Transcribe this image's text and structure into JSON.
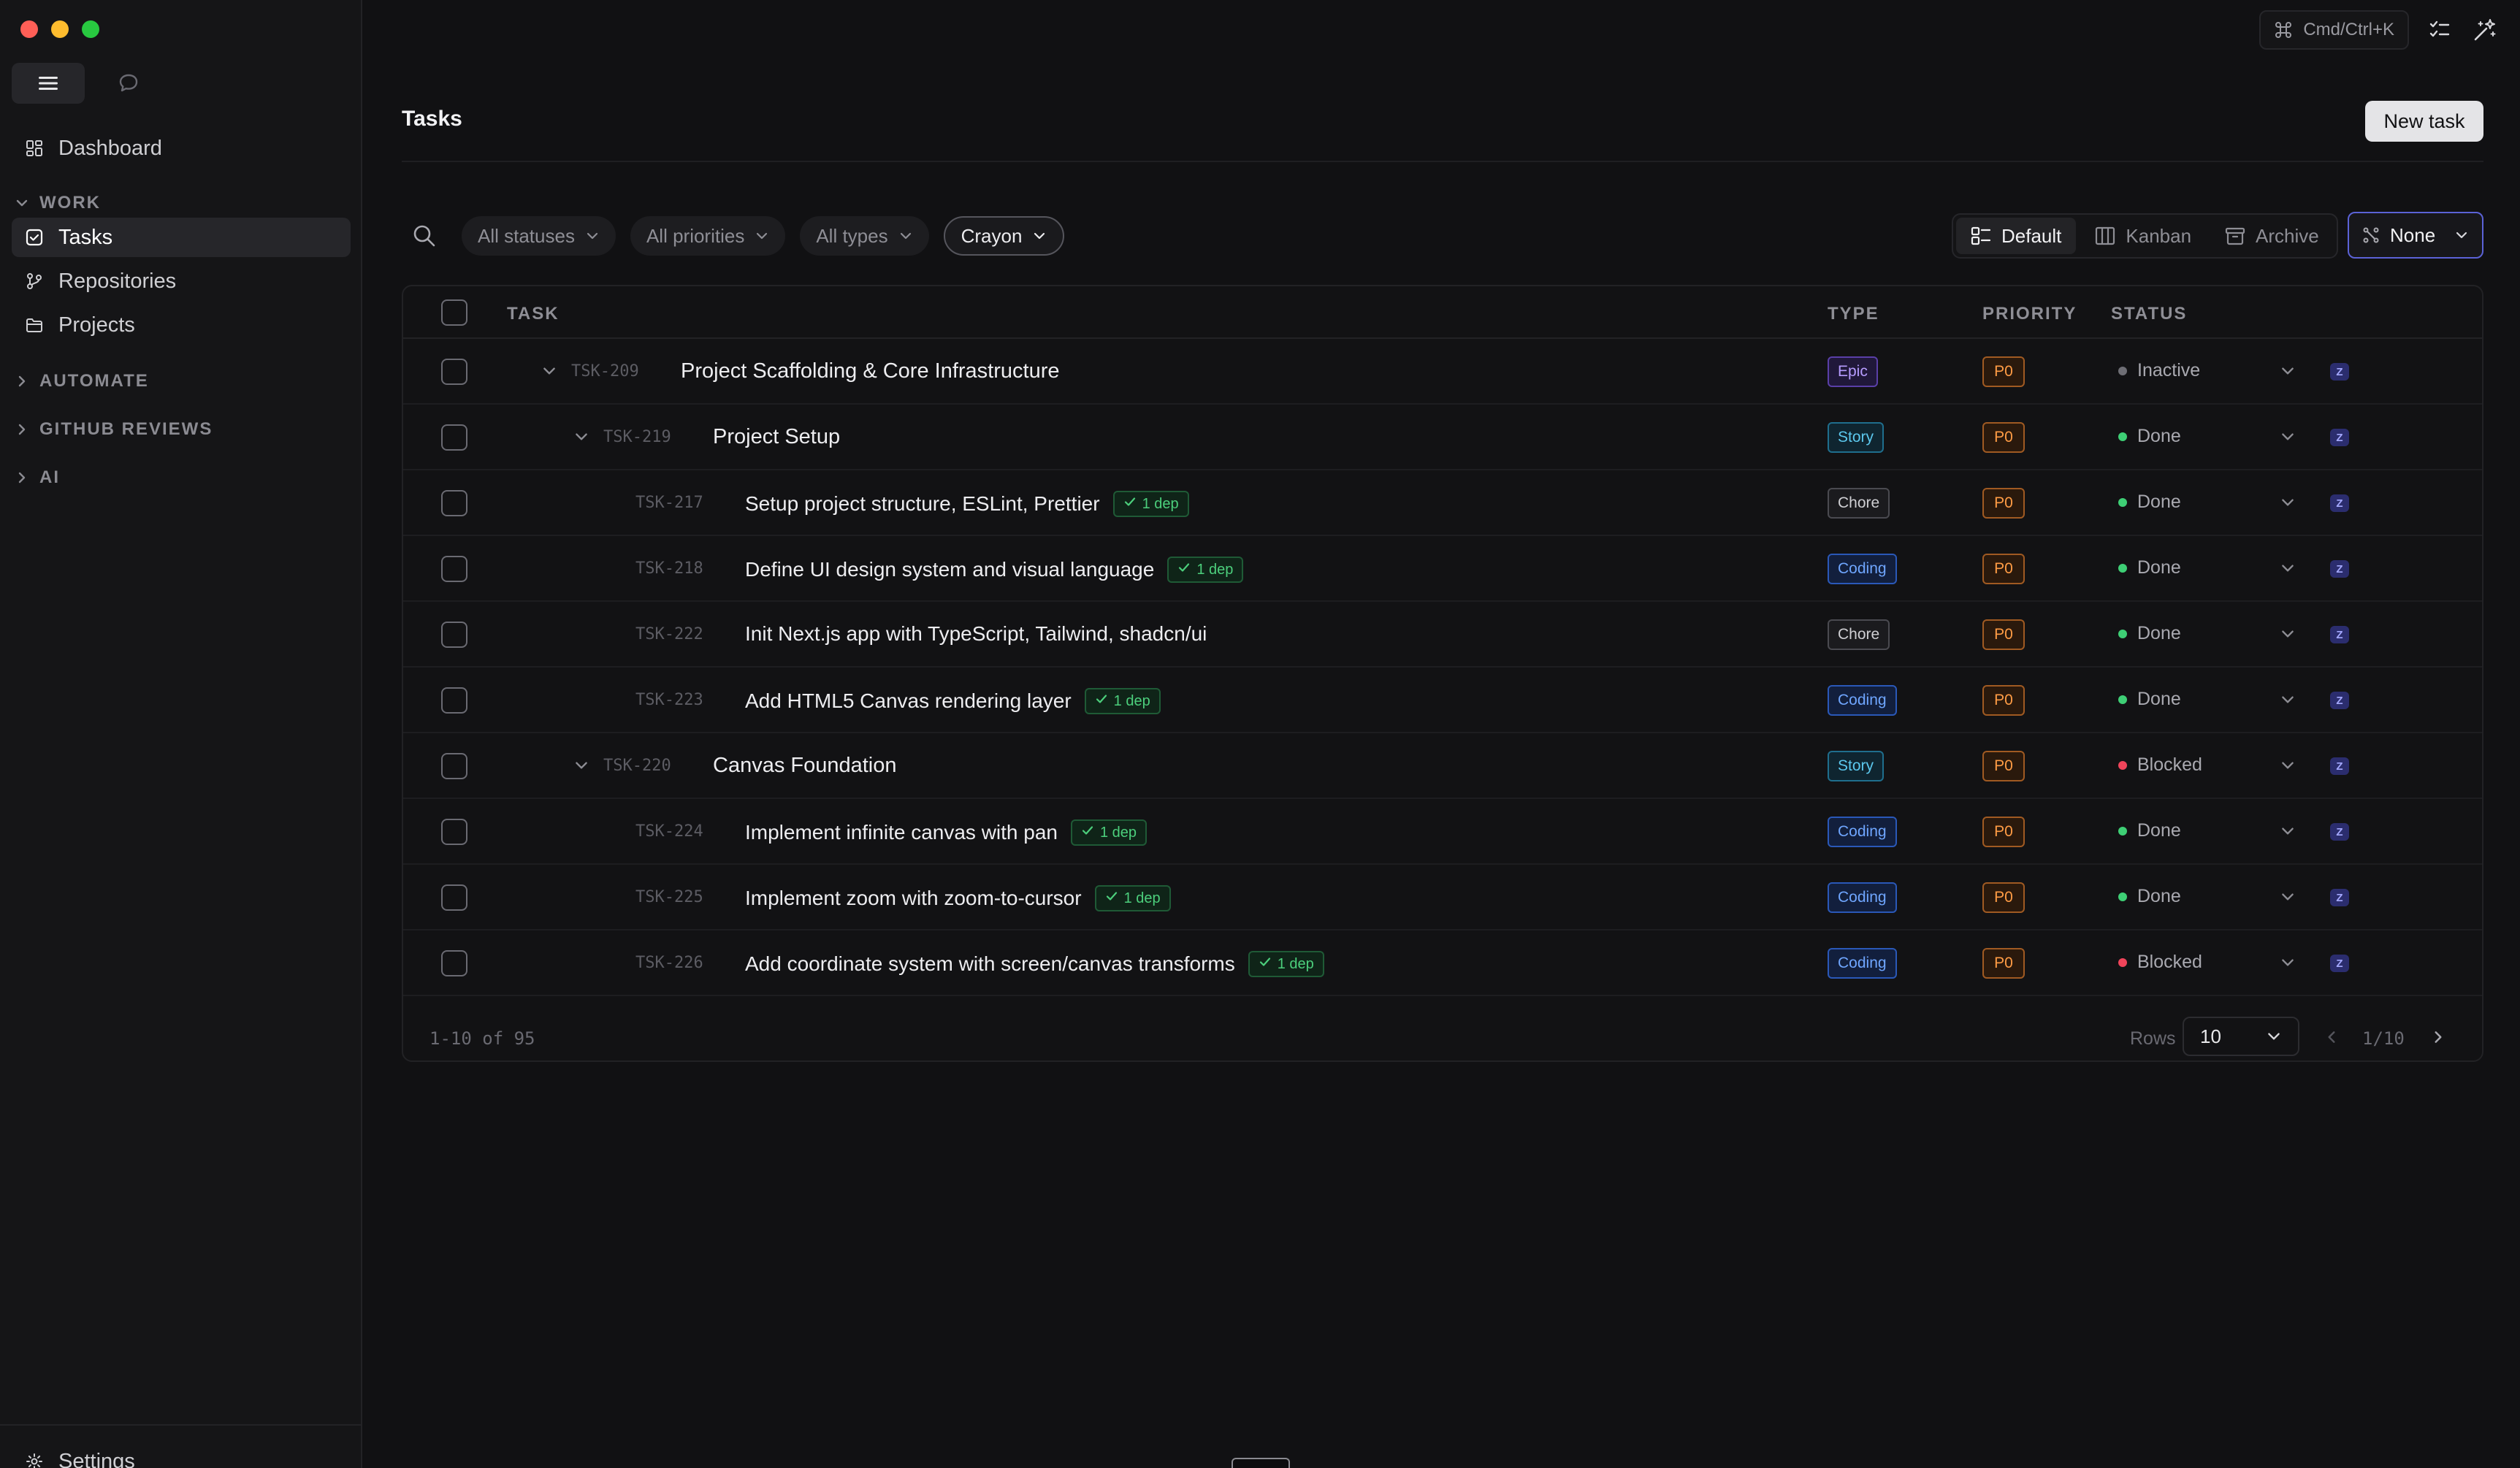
{
  "sidebar": {
    "dashboard": "Dashboard",
    "section_work": "WORK",
    "tasks": "Tasks",
    "repositories": "Repositories",
    "projects": "Projects",
    "section_automate": "AUTOMATE",
    "section_github": "GITHUB REVIEWS",
    "section_ai": "AI",
    "settings": "Settings"
  },
  "topbar": {
    "command_shortcut": "Cmd/Ctrl+K"
  },
  "page": {
    "title": "Tasks",
    "new_task": "New task"
  },
  "filters": {
    "status": "All statuses",
    "priority": "All priorities",
    "type": "All types",
    "project": "Crayon"
  },
  "views": {
    "default": "Default",
    "kanban": "Kanban",
    "archive": "Archive",
    "group_by": "None"
  },
  "table": {
    "headers": {
      "task": "TASK",
      "type": "TYPE",
      "priority": "PRIORITY",
      "status": "STATUS"
    },
    "rows": [
      {
        "id": "TSK-209",
        "title": "Project Scaffolding & Core Infrastructure",
        "dep": "",
        "type": "Epic",
        "priority": "P0",
        "status": "Inactive",
        "assignee": "Z"
      },
      {
        "id": "TSK-219",
        "title": "Project Setup",
        "dep": "",
        "type": "Story",
        "priority": "P0",
        "status": "Done",
        "assignee": "Z"
      },
      {
        "id": "TSK-217",
        "title": "Setup project structure, ESLint, Prettier",
        "dep": "1 dep",
        "type": "Chore",
        "priority": "P0",
        "status": "Done",
        "assignee": "Z"
      },
      {
        "id": "TSK-218",
        "title": "Define UI design system and visual language",
        "dep": "1 dep",
        "type": "Coding",
        "priority": "P0",
        "status": "Done",
        "assignee": "Z"
      },
      {
        "id": "TSK-222",
        "title": "Init Next.js app with TypeScript, Tailwind, shadcn/ui",
        "dep": "",
        "type": "Chore",
        "priority": "P0",
        "status": "Done",
        "assignee": "Z"
      },
      {
        "id": "TSK-223",
        "title": "Add HTML5 Canvas rendering layer",
        "dep": "1 dep",
        "type": "Coding",
        "priority": "P0",
        "status": "Done",
        "assignee": "Z"
      },
      {
        "id": "TSK-220",
        "title": "Canvas Foundation",
        "dep": "",
        "type": "Story",
        "priority": "P0",
        "status": "Blocked",
        "assignee": "Z"
      },
      {
        "id": "TSK-224",
        "title": "Implement infinite canvas with pan",
        "dep": "1 dep",
        "type": "Coding",
        "priority": "P0",
        "status": "Done",
        "assignee": "Z"
      },
      {
        "id": "TSK-225",
        "title": "Implement zoom with zoom-to-cursor",
        "dep": "1 dep",
        "type": "Coding",
        "priority": "P0",
        "status": "Done",
        "assignee": "Z"
      },
      {
        "id": "TSK-226",
        "title": "Add coordinate system with screen/canvas transforms",
        "dep": "1 dep",
        "type": "Coding",
        "priority": "P0",
        "status": "Blocked",
        "assignee": "Z"
      }
    ]
  },
  "footer": {
    "range": "1-10 of 95",
    "rows_label": "Rows",
    "rows_value": "10",
    "page": "1/10"
  },
  "colors": {
    "done": "#3ecf75",
    "blocked": "#f0445a",
    "inactive": "#6e6e75",
    "accent": "#5b62d6"
  }
}
